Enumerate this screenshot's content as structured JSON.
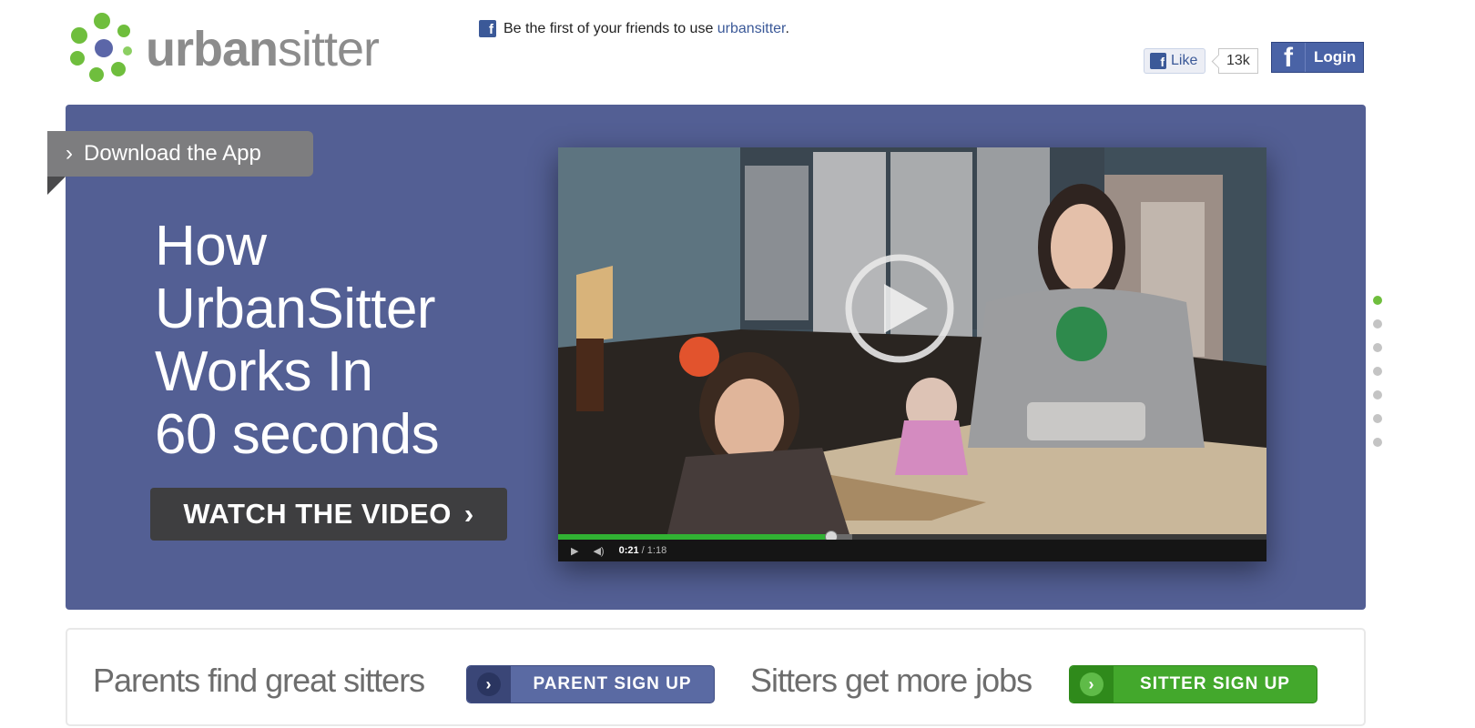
{
  "header": {
    "logo_text_bold": "urban",
    "logo_text_light": "sitter",
    "fb_notice_prefix": "Be the first of your friends to use ",
    "fb_notice_link": "urbansitter",
    "fb_notice_suffix": ".",
    "like_label": "Like",
    "like_count": "13k",
    "login_label": "Login"
  },
  "hero": {
    "download_label": "Download the App",
    "title_lines": [
      "How",
      "UrbanSitter",
      "Works In",
      "60 seconds"
    ],
    "watch_label": "WATCH THE VIDEO",
    "background_color": "#535f94"
  },
  "video": {
    "current_time": "0:21",
    "duration": "1:18",
    "progress_fraction": 0.386,
    "buffered_fraction": 0.415
  },
  "pager": {
    "count": 7,
    "active_index": 0
  },
  "signup": {
    "parent_text": "Parents find great sitters",
    "parent_button": "PARENT SIGN UP",
    "sitter_text": "Sitters get more jobs",
    "sitter_button": "SITTER SIGN UP"
  },
  "colors": {
    "brand_green": "#6fbe3d",
    "brand_blue": "#535f94",
    "facebook_blue": "#3b5998"
  }
}
